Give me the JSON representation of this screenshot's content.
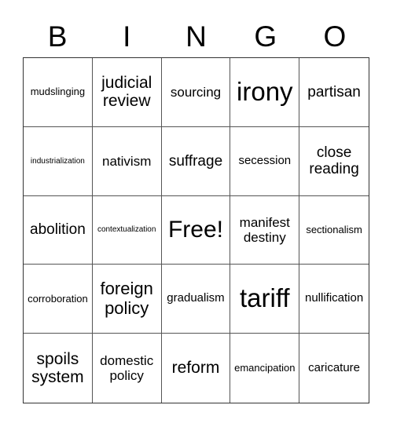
{
  "header": [
    "B",
    "I",
    "N",
    "G",
    "O"
  ],
  "cells": [
    {
      "text": "mudslinging",
      "size": "s13"
    },
    {
      "text": "judicial review",
      "size": "s21"
    },
    {
      "text": "sourcing",
      "size": "s17"
    },
    {
      "text": "irony",
      "size": "s33"
    },
    {
      "text": "partisan",
      "size": "s19"
    },
    {
      "text": "industrialization",
      "size": "s10"
    },
    {
      "text": "nativism",
      "size": "s17"
    },
    {
      "text": "suffrage",
      "size": "s19"
    },
    {
      "text": "secession",
      "size": "s15"
    },
    {
      "text": "close reading",
      "size": "s19"
    },
    {
      "text": "abolition",
      "size": "s19"
    },
    {
      "text": "contextualization",
      "size": "s10"
    },
    {
      "text": "Free!",
      "size": "s30"
    },
    {
      "text": "manifest destiny",
      "size": "s17"
    },
    {
      "text": "sectionalism",
      "size": "s13"
    },
    {
      "text": "corroboration",
      "size": "s13"
    },
    {
      "text": "foreign policy",
      "size": "s22"
    },
    {
      "text": "gradualism",
      "size": "s15"
    },
    {
      "text": "tariff",
      "size": "s33"
    },
    {
      "text": "nullification",
      "size": "s15"
    },
    {
      "text": "spoils system",
      "size": "s21"
    },
    {
      "text": "domestic policy",
      "size": "s17"
    },
    {
      "text": "reform",
      "size": "s21"
    },
    {
      "text": "emancipation",
      "size": "s13"
    },
    {
      "text": "caricature",
      "size": "s15"
    }
  ]
}
